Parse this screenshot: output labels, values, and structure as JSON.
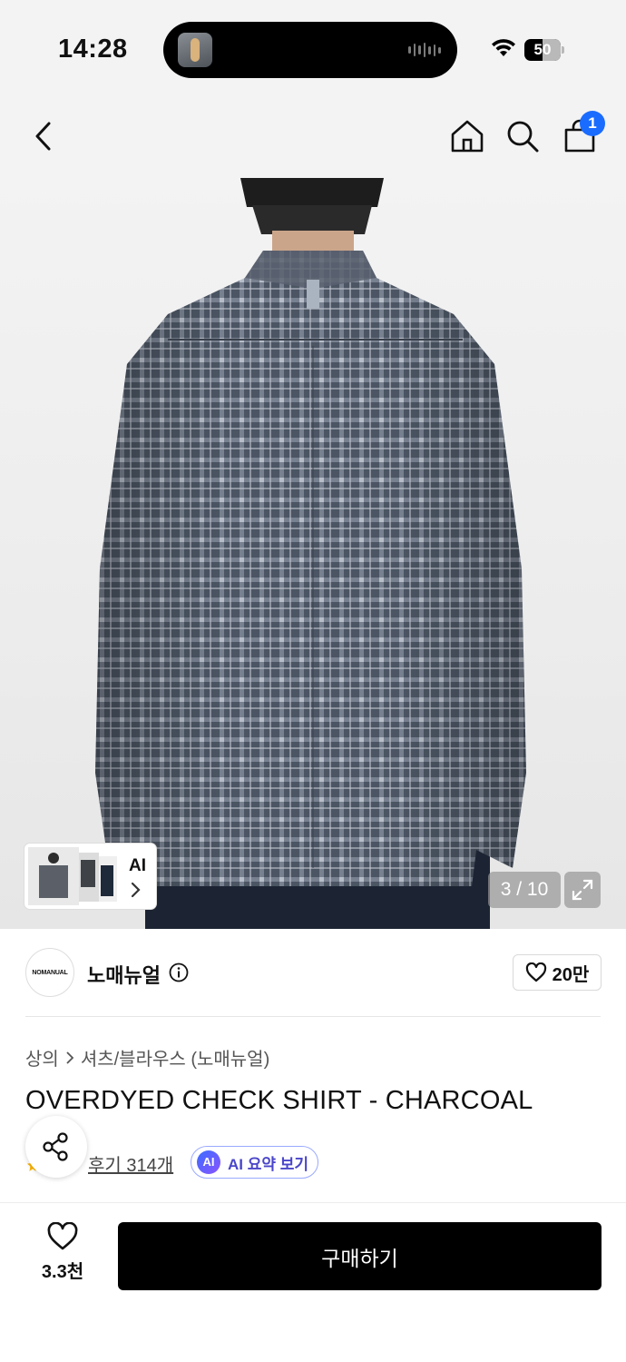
{
  "status_bar": {
    "time": "14:28",
    "battery": "50",
    "battery_level": 0.5
  },
  "header": {
    "icons": [
      "back-chevron-icon",
      "home-icon",
      "search-icon",
      "shopping-bag-icon"
    ],
    "cart_count": "1"
  },
  "gallery": {
    "page_indicator": "3 / 10",
    "ai_shortcut_label": "AI"
  },
  "brand": {
    "logo_text": "NOMANUAL",
    "name": "노매뉴얼",
    "like_count": "20만"
  },
  "product": {
    "breadcrumb": [
      "상의",
      "셔츠/블라우스 (노매뉴얼)"
    ],
    "title": "OVERDYED CHECK SHIRT - CHARCOAL",
    "reviews_label": "후기 314개",
    "ai_summary_badge": "AI",
    "ai_summary_label": "AI 요약 보기"
  },
  "bottom_bar": {
    "wish_count": "3.3천",
    "buy_label": "구매하기"
  },
  "colors": {
    "accent_blue": "#1a6cff",
    "buy_button": "#000000",
    "ai_purple": "#4a46c9"
  }
}
